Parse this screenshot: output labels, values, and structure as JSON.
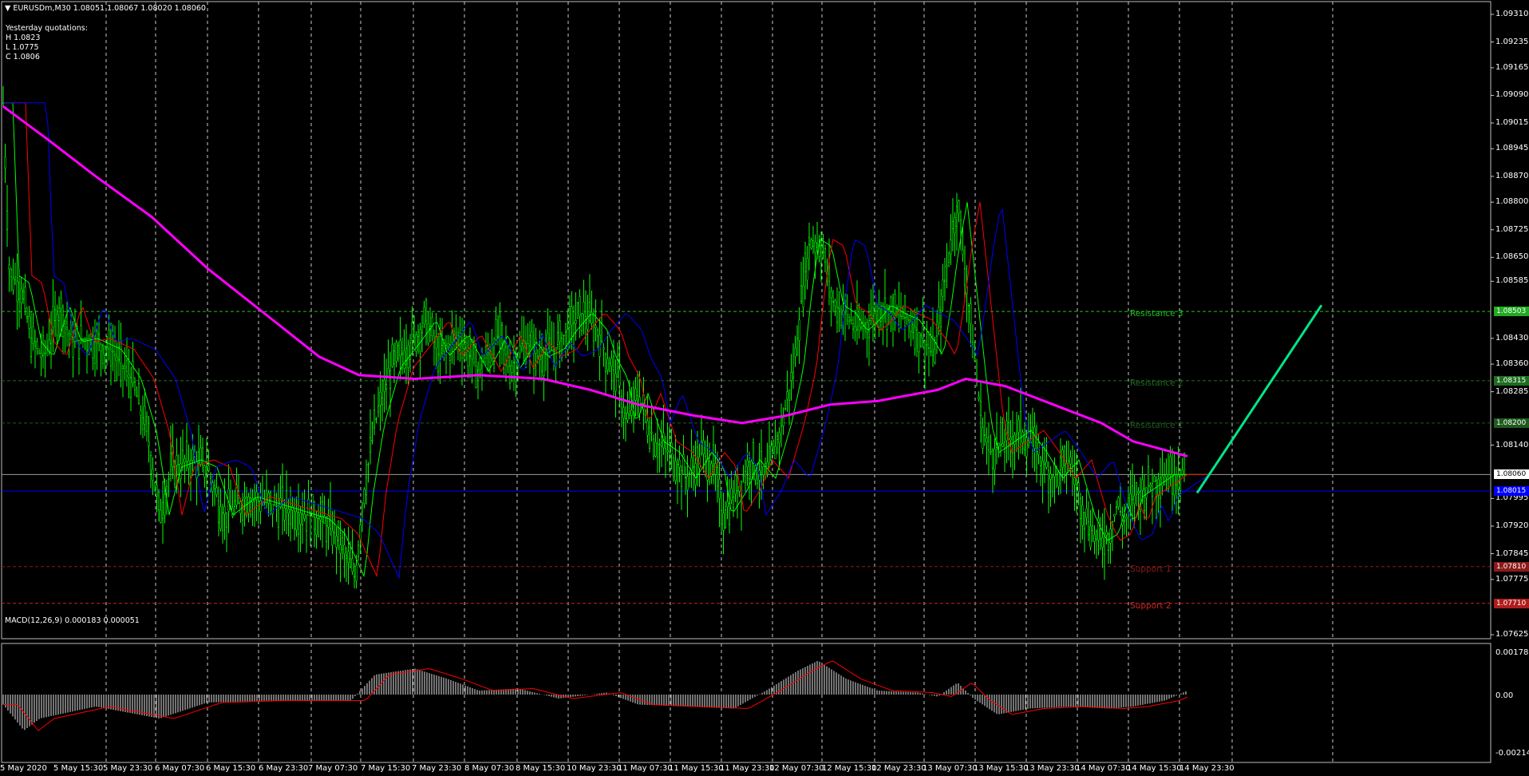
{
  "header": {
    "title": "EURUSDm,M30  1.08051 1.08067 1.08020 1.08060",
    "yesterday_label": "Yesterday quotations:",
    "yesterday_high": "H 1.0823",
    "yesterday_low": "L 1.0775",
    "yesterday_close": "C 1.0806"
  },
  "macd_label": "MACD(12,26,9) 0.000183 0.000051",
  "price_axis": [
    "1.09310",
    "1.09235",
    "1.09165",
    "1.09090",
    "1.09015",
    "1.08945",
    "1.08870",
    "1.08800",
    "1.08725",
    "1.08650",
    "1.08585",
    "1.08430",
    "1.08360",
    "1.08285",
    "1.08140",
    "1.07995",
    "1.07920",
    "1.07845",
    "1.07775",
    "1.07625"
  ],
  "macd_axis": [
    "0.001785",
    "0.00",
    "-0.002145"
  ],
  "time_axis": [
    "5 May 2020",
    "5 May 15:30",
    "5 May 23:30",
    "6 May 07:30",
    "6 May 15:30",
    "6 May 23:30",
    "7 May 07:30",
    "7 May 15:30",
    "7 May 23:30",
    "8 May 07:30",
    "8 May 15:30",
    "10 May 23:30",
    "11 May 07:30",
    "11 May 15:30",
    "11 May 23:30",
    "12 May 07:30",
    "12 May 15:30",
    "12 May 23:30",
    "13 May 07:30",
    "13 May 15:30",
    "13 May 23:30",
    "14 May 07:30",
    "14 May 15:30",
    "14 May 23:30"
  ],
  "levels": [
    {
      "name": "Resistance 3",
      "value": "1.08503",
      "color": "#22c022",
      "badge_bg": "#22aa22"
    },
    {
      "name": "Resistance 2",
      "value": "1.08315",
      "color": "#1f6e1f",
      "badge_bg": "#1f6e1f"
    },
    {
      "name": "Resistance 1",
      "value": "1.08200",
      "color": "#1f5a1f",
      "badge_bg": "#1f5a1f"
    },
    {
      "name": "Support 1",
      "value": "1.07810",
      "color": "#8b1a1a",
      "badge_bg": "#8b1a1a"
    },
    {
      "name": "Support 2",
      "value": "1.07710",
      "color": "#cc2222",
      "badge_bg": "#b01c1c"
    }
  ],
  "current_price": "1.08060",
  "bid_line_price": "1.08015",
  "colors": {
    "candles": "#00ff00",
    "ma_slow": "#ff00ff",
    "ma_blue": "#0000ff",
    "ma_red": "#ff0000",
    "ma_green": "#00ff00",
    "forecast_arrow": "#00e68a",
    "macd_hist": "#c0c0c0",
    "macd_signal": "#ff0000",
    "grid": "#c8c8c8"
  }
}
